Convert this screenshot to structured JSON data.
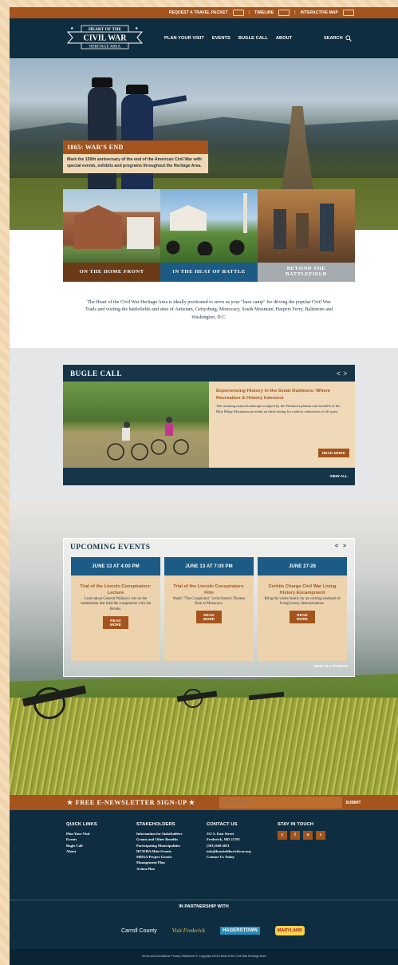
{
  "topbar": {
    "travel_packet": "REQUEST A TRAVEL PACKET",
    "timeline": "TIMELINE",
    "interactive_map": "INTERACTIVE MAP",
    "separator": "|"
  },
  "logo": {
    "line1": "HEART OF THE",
    "line2": "CIVIL WAR",
    "line3": "HERITAGE AREA"
  },
  "nav": {
    "items": [
      "PLAN YOUR VISIT",
      "EVENTS",
      "BUGLE CALL",
      "ABOUT"
    ],
    "search_label": "SEARCH"
  },
  "hero": {
    "title": "1865: WAR'S END",
    "body": "Mark the 150th anniversary of the end of the American Civil War with special events, exhibits and programs throughout the Heritage Area."
  },
  "tiles": [
    {
      "label": "ON THE HOME FRONT",
      "color": "#6b3a16"
    },
    {
      "label": "IN THE HEAT OF BATTLE",
      "color": "#1b5b86"
    },
    {
      "label": "BEYOND THE BATTLEFIELD",
      "color": "#a6abaf"
    }
  ],
  "intro": {
    "text": "The Heart of the Civil War Heritage Area is ideally positioned to serve as your \"base camp\" for driving the popular Civil War Trails and visiting the battlefields and sites of Antietam, Gettysburg, Monocacy, South Mountain, Harpers Ferry, Baltimore and Washington, D.C."
  },
  "bugle": {
    "title": "BUGLE CALL",
    "arrows": "< >",
    "headline": "Experiencing History in the Great Outdoors: Where Recreation & History Intersect",
    "body": "The stunning natural landscape sculpted by the Piedmont plateau and foothills of the Blue Ridge Mountains provides an ideal setting for outdoor enthusiasts of all types.",
    "read_more": "READ MORE",
    "view_all": "VIEW ALL"
  },
  "events": {
    "title": "UPCOMING EVENTS",
    "arrows": "< >",
    "cards": [
      {
        "date": "JUNE 13 AT 4:00 PM",
        "title": "Trial of the Lincoln Conspirators: Lecture",
        "body": "Learn about General Wallace's role on the commission that tried the conspirators with Joe Brooks.",
        "button": "READ MORE"
      },
      {
        "date": "JUNE 13 AT 7:00 PM",
        "title": "Trial of the Lincoln Conspirators: Film",
        "body": "Watch \"The Conspirator\" in the historic Thomas Barn at Monocacy.",
        "button": "READ MORE"
      },
      {
        "date": "JUNE 27-28",
        "title": "Corbits Charge Civil War Living History Encampment",
        "body": "Bring the whole family for an exciting weekend of living history demonstrations.",
        "button": "READ MORE"
      }
    ],
    "view_all": "VIEW ALL EVENTS"
  },
  "newsletter": {
    "title": "★ FREE E-NEWSLETTER SIGN-UP ★",
    "placeholder": "Enter Email Here",
    "submit": "SUBMIT"
  },
  "footer": {
    "quick_links": {
      "title": "QUICK LINKS",
      "items": [
        "Plan Your Visit",
        "Events",
        "Bugle Call",
        "About"
      ]
    },
    "stakeholders": {
      "title": "STAKEHOLDERS",
      "items": [
        "Information for Stakeholders",
        "Grants and Other Benefits",
        "Participating Municipalities",
        "HCWHA Mini-Grants",
        "MHAA Project Grants",
        "Management Plan",
        "Action Plan"
      ]
    },
    "contact": {
      "title": "CONTACT US",
      "items": [
        "151 S. East Street",
        "Frederick, MD 21701",
        "(301) 600-4031",
        "info@heartofthecivilwar.org",
        "Contact Us Today"
      ]
    },
    "social": {
      "title": "STAY IN TOUCH",
      "icons": [
        "y",
        "f",
        "o",
        "v"
      ]
    },
    "partnership_title": "IN PARTNERSHIP WITH",
    "partners": [
      "Carroll County",
      "Visit Frederick",
      "HAGERSTOWN",
      "MARYLAND"
    ],
    "copyright": "Terms and Conditions    Privacy Statement    © Copyright 2015 Heart of the Civil War Heritage Area"
  }
}
